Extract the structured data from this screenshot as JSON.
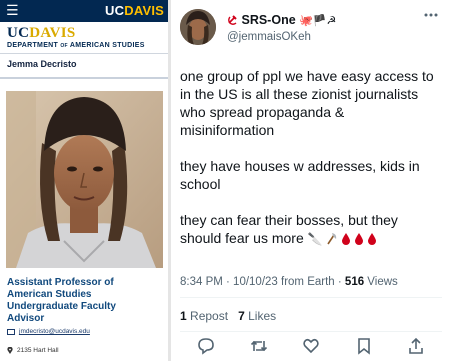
{
  "profile_page": {
    "header": {
      "menu_icon": "hamburger-icon",
      "logo_uc": "UC",
      "logo_davis": "DAVIS"
    },
    "brand": {
      "uc": "UC",
      "davis": "DAVIS",
      "dept_prefix": "DEPARTMENT",
      "dept_of": "OF",
      "dept_suffix": "AMERICAN STUDIES"
    },
    "person_name": "Jemma Decristo",
    "title_lines": [
      "Assistant Professor of",
      "American Studies",
      "Undergraduate Faculty",
      "Advisor"
    ],
    "email": "jmdecristo@ucdavis.edu",
    "address": "2135 Hart Hall",
    "colors": {
      "navy": "#022851",
      "gold": "#daaa00",
      "link": "#11497d"
    }
  },
  "tweet": {
    "display_name": "SRS-One",
    "name_emojis": "🐙🏴☭",
    "handle": "@jemmaisOKeh",
    "paragraphs": [
      [
        "one group of ppl we have easy access to",
        "in the US is all these zionist journalists",
        "who spread propaganda &",
        "misiniformation"
      ],
      [
        "they have houses w addresses, kids in",
        "school"
      ],
      [
        "they can fear their bosses, but they"
      ]
    ],
    "last_line_text": "should fear us more",
    "last_line_emojis": "🔪",
    "timestamp": "8:34 PM · 10/10/23 from Earth · ",
    "views_count": "516",
    "views_label": " Views",
    "reposts_count": "1",
    "reposts_label": "Repost",
    "likes_count": "7",
    "likes_label": "Likes",
    "actions": [
      "reply-icon",
      "repost-icon",
      "like-icon",
      "bookmark-icon",
      "share-icon"
    ],
    "colors": {
      "text": "#0f1419",
      "muted": "#536471",
      "blood": "#d0021b"
    }
  }
}
